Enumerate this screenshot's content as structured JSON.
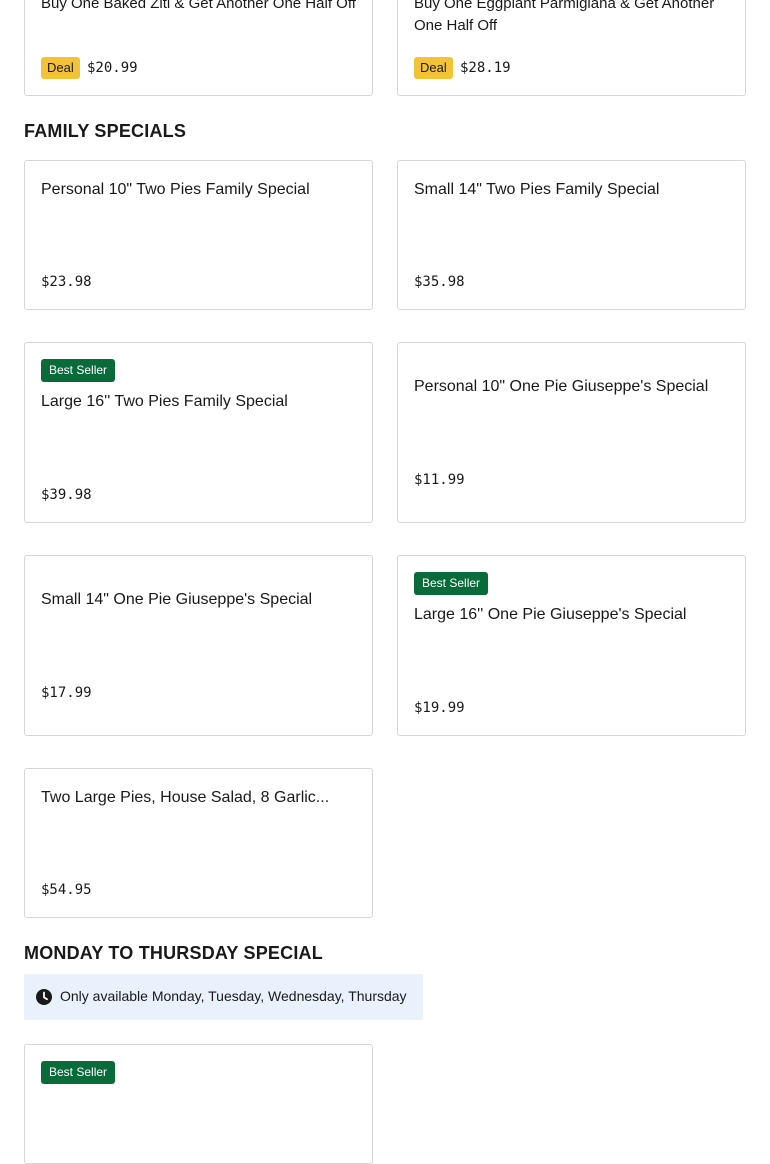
{
  "deals": [
    {
      "name": "Buy One Baked Ziti & Get Another One Half Off",
      "badge": "Deal",
      "price": "$20.99"
    },
    {
      "name": "Buy One Eggplant Parmigiana & Get Another One Half Off",
      "badge": "Deal",
      "price": "$28.19"
    }
  ],
  "family_section": {
    "title": "FAMILY SPECIALS",
    "items": [
      {
        "name": "Personal 10\" Two Pies Family Special",
        "price": "$23.98"
      },
      {
        "name": "Small 14\" Two Pies Family Special",
        "price": "$35.98"
      },
      {
        "badge": "Best Seller",
        "name": "Large 16'' Two Pies Family Special",
        "price": "$39.98"
      },
      {
        "name": "Personal 10\" One Pie Giuseppe's Special",
        "price": "$11.99"
      },
      {
        "name": "Small 14\" One Pie Giuseppe's Special",
        "price": "$17.99"
      },
      {
        "badge": "Best Seller",
        "name": "Large 16'' One Pie Giuseppe's Special",
        "price": "$19.99"
      },
      {
        "name": "Two Large Pies, House Salad, 8 Garlic...",
        "price": "$54.95"
      }
    ]
  },
  "monday_section": {
    "title": "MONDAY TO THURSDAY SPECIAL",
    "notice_icon": "clock-icon",
    "notice": "Only available Monday, Tuesday, Wednesday, Thursday",
    "items": [
      {
        "badge": "Best Seller"
      }
    ]
  },
  "colors": {
    "best_seller_bg": "#0a6b3a",
    "deal_bg": "#f4c236",
    "notice_bg": "#e8f1fc",
    "card_border": "#d6d6d6"
  }
}
